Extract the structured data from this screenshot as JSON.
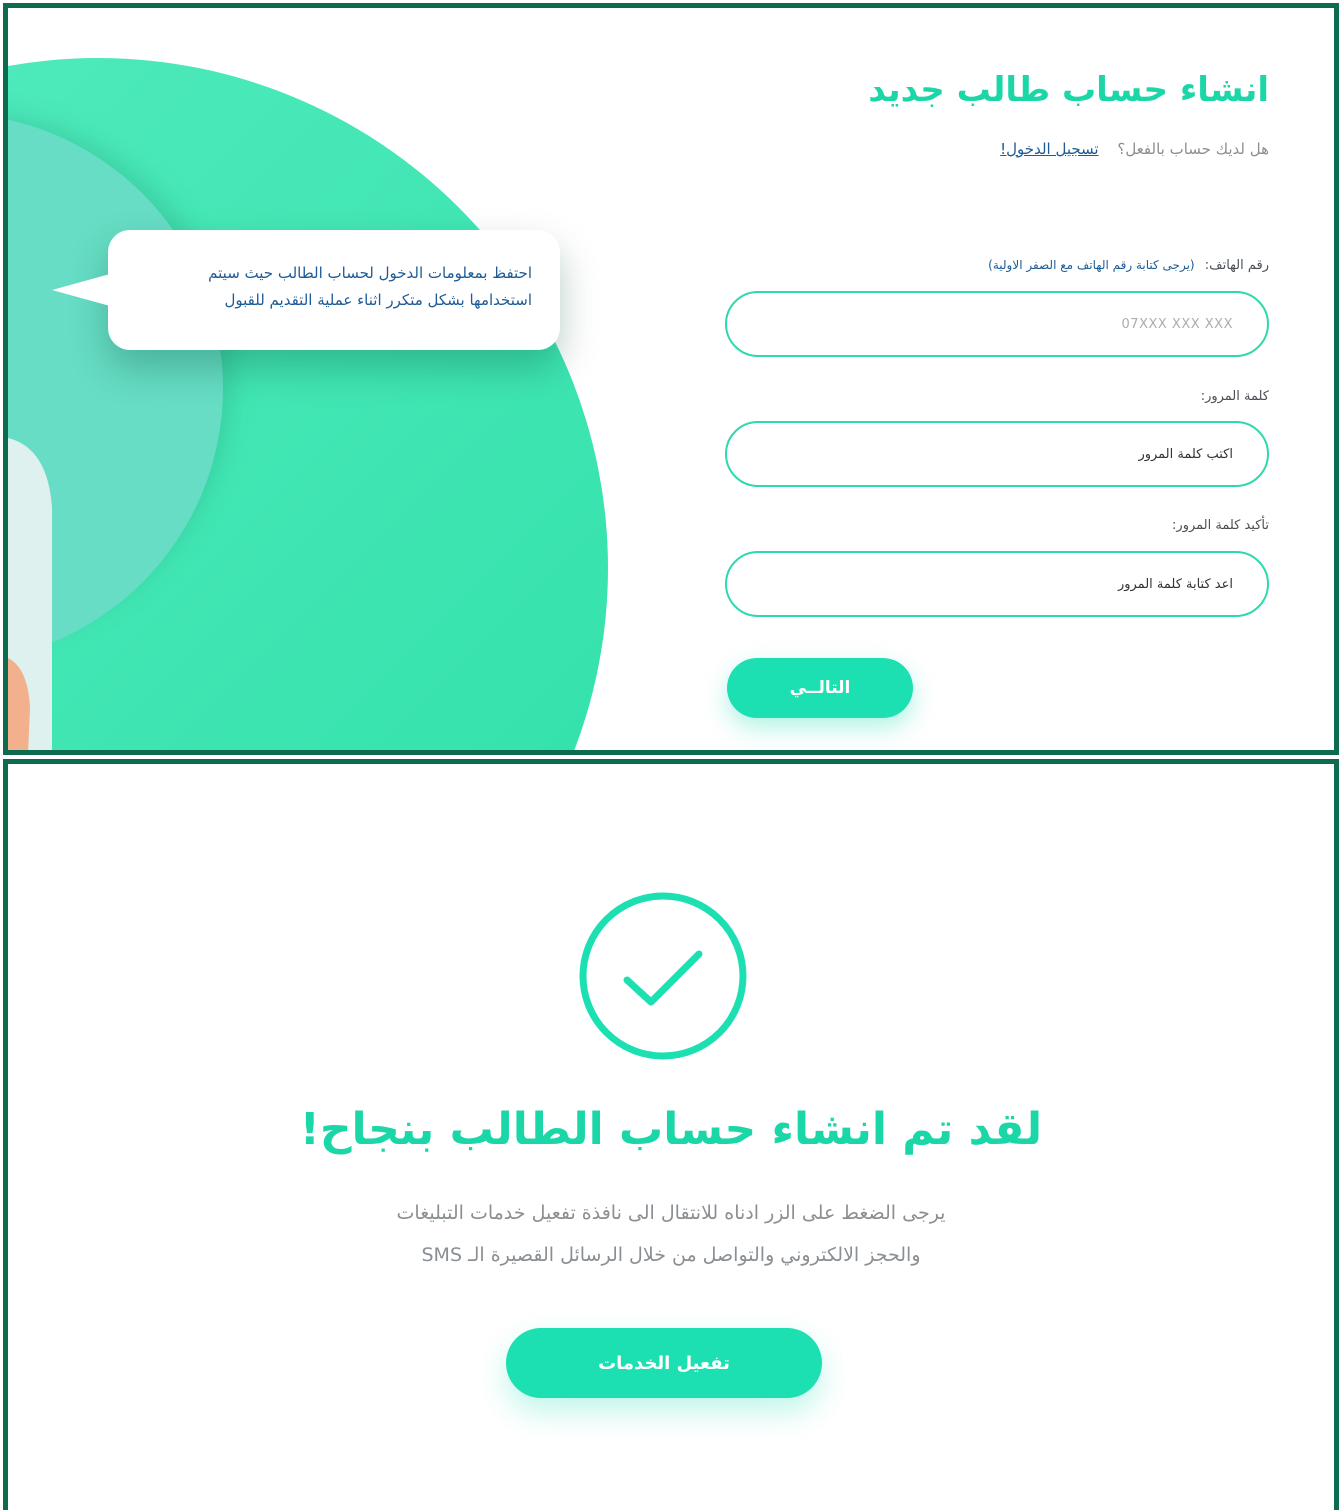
{
  "registration": {
    "title": "انشاء حساب طالب جديد",
    "login_question": "هل لديك حساب بالفعل؟",
    "login_link": "تسجيل الدخول!",
    "tooltip": {
      "line1": "احتفظ بمعلومات الدخول لحساب الطالب حيث سيتم",
      "line2": "استخدامها بشكل متكرر اثناء عملية التقديم للقبول"
    },
    "phone": {
      "label": "رقم الهاتف:",
      "hint": "(يرجى كتابة رقم الهاتف مع الصفر الاولية)",
      "placeholder": "07XXX XXX XXX"
    },
    "password": {
      "label": "كلمة المرور:",
      "placeholder": "اكتب كلمة المرور"
    },
    "confirm_password": {
      "label": "تأكيد كلمة المرور:",
      "placeholder": "اعد كتابة كلمة المرور"
    },
    "next_button": "التالــي"
  },
  "success": {
    "title": "لقد تم انشاء حساب الطالب بنجاح!",
    "text_line1": "يرجى الضغط على الزر ادناه للانتقال الى نافذة تفعيل خدمات التبليغات",
    "text_line2": "والحجز الالكتروني والتواصل من خلال الرسائل القصيرة الـ SMS",
    "activate_button": "تفعيل الخدمات"
  },
  "colors": {
    "accent": "#1de0b2",
    "title_green": "#1bd6a6",
    "border_dark_green": "#0f6b4f",
    "link_blue": "#1d5b96",
    "muted_text": "#8a8f93"
  },
  "icons": {
    "success": "check-circle-icon"
  }
}
